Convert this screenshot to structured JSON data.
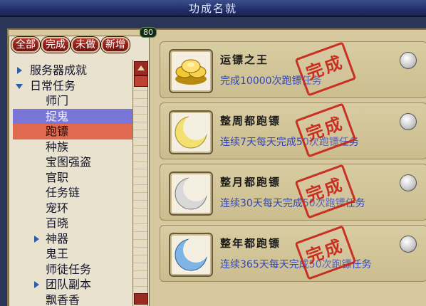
{
  "window": {
    "title": "功成名就"
  },
  "tabs": [
    {
      "label": "全部"
    },
    {
      "label": "完成"
    },
    {
      "label": "未做"
    },
    {
      "label": "新增"
    }
  ],
  "badge": "80",
  "tree": [
    {
      "label": "服务器成就",
      "level": 0,
      "arrow": "right"
    },
    {
      "label": "日常任务",
      "level": 0,
      "arrow": "down"
    },
    {
      "label": "师门",
      "level": 1
    },
    {
      "label": "捉鬼",
      "level": 1,
      "state": "selected-blue"
    },
    {
      "label": "跑镖",
      "level": 1,
      "state": "selected-red"
    },
    {
      "label": "种族",
      "level": 1
    },
    {
      "label": "宝图强盗",
      "level": 1
    },
    {
      "label": "官职",
      "level": 1
    },
    {
      "label": "任务链",
      "level": 1
    },
    {
      "label": "宠环",
      "level": 1
    },
    {
      "label": "百晓",
      "level": 1
    },
    {
      "label": "神器",
      "level": 1,
      "arrow": "right"
    },
    {
      "label": "鬼王",
      "level": 1
    },
    {
      "label": "师徒任务",
      "level": 1
    },
    {
      "label": "团队副本",
      "level": 1,
      "arrow": "right"
    },
    {
      "label": "飘香香",
      "level": 1
    }
  ],
  "achievements": [
    {
      "name": "运镖之王",
      "desc": "完成10000次跑镖任务",
      "stamp": "完成",
      "icon": "gold-ingots-icon"
    },
    {
      "name": "整周都跑镖",
      "desc": "连续7天每天完成50次跑镖任务",
      "stamp": "完成",
      "icon": "gold-crescent-moon-icon"
    },
    {
      "name": "整月都跑镖",
      "desc": "连续30天每天完成50次跑镖任务",
      "stamp": "完成",
      "icon": "silver-crescent-moon-icon"
    },
    {
      "name": "整年都跑镖",
      "desc": "连续365天每天完成50次跑镖任务",
      "stamp": "完成",
      "icon": "blue-crescent-moon-icon"
    }
  ],
  "colors": {
    "selected_blue": "#7a76d8",
    "selected_red": "#e06a50",
    "stamp_red": "#c82418",
    "desc_blue": "#3346b8"
  }
}
